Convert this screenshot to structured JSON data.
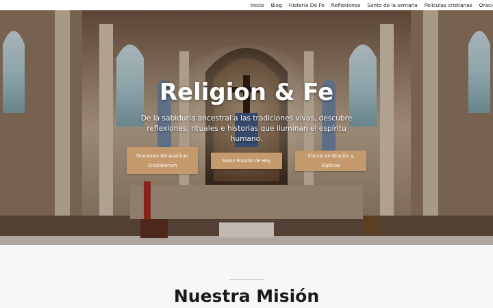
{
  "nav": {
    "items": [
      {
        "label": "Inicio"
      },
      {
        "label": "Blog"
      },
      {
        "label": "Historia De Fe"
      },
      {
        "label": "Reflexiones"
      },
      {
        "label": "Santo de la semana"
      },
      {
        "label": "Películas cristianas"
      },
      {
        "label": "Oraciones"
      }
    ]
  },
  "hero": {
    "title": "Religion & Fe",
    "subtitle": "De la sabiduría ancestral a las tradiciones vivas, descubre reflexiones, rituales e historias que iluminan el espíritu humano.",
    "buttons": [
      {
        "label": "Oraciones del Auxilium Cristianorum"
      },
      {
        "label": "Santo Rosario de Hoy"
      },
      {
        "label": "Círculo de Oración y Súplicas"
      }
    ]
  },
  "mission": {
    "title": "Nuestra Misión"
  },
  "colors": {
    "accent": "#c49a6c",
    "section_bg": "#f7f7f7"
  }
}
